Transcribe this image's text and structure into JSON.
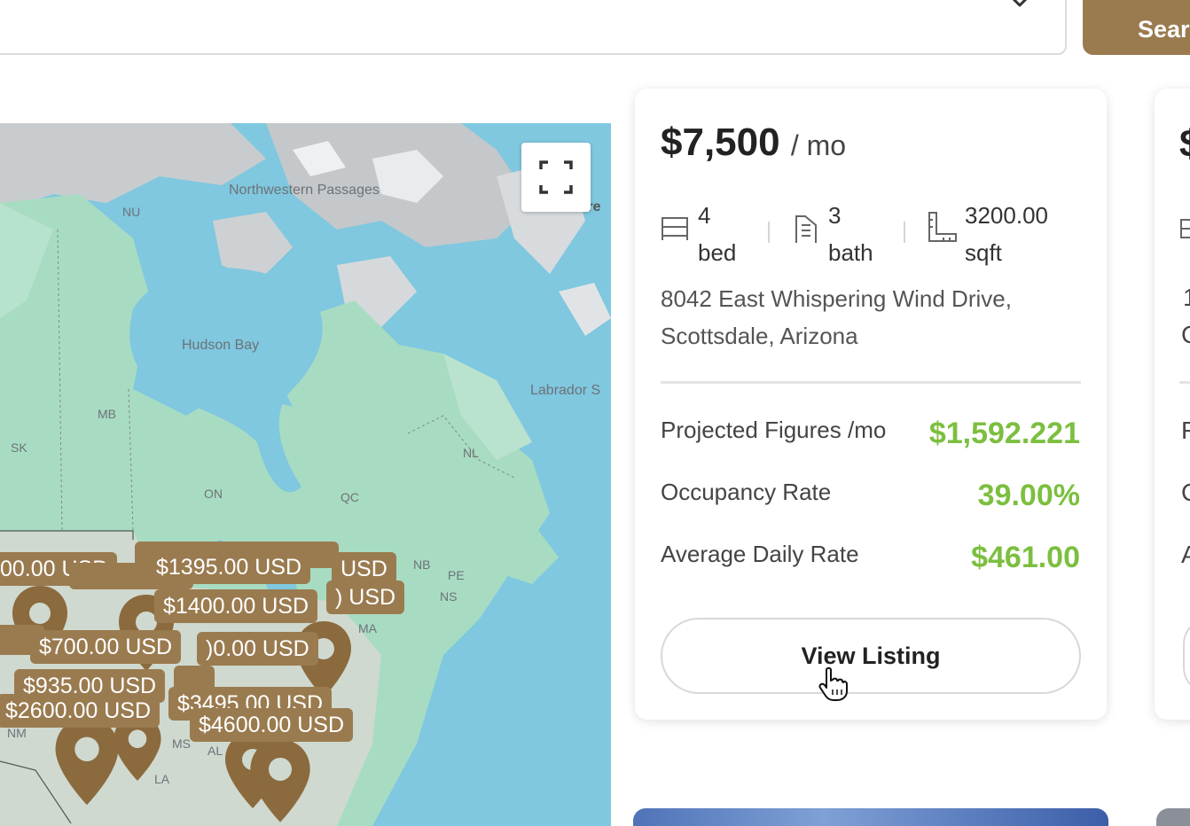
{
  "search": {
    "button_label": "Sear",
    "dropdown_icon": "chevron-down-icon"
  },
  "map": {
    "labels": {
      "northwestern_passages": "Northwestern Passages",
      "nu": "NU",
      "hudson_bay": "Hudson Bay",
      "labrador": "Labrador S",
      "mb": "MB",
      "sk": "SK",
      "on": "ON",
      "qc": "QC",
      "nl": "NL",
      "nb": "NB",
      "pe": "PE",
      "ns": "NS",
      "ma": "MA",
      "nm": "NM",
      "ms": "MS",
      "al": "AL",
      "la": "LA",
      "gre": "Gre"
    },
    "price_tags": [
      "00.00 USD",
      "$1395.00 USD",
      "USD",
      "$1400.00 USD",
      ") USD",
      "$700.00 USD",
      ")0.00 USD",
      "$935.00 USD",
      "$2600.00 USD",
      "$3495.00 USD",
      "$4600.00 USD"
    ],
    "fullscreen_icon": "fullscreen-icon",
    "pin_color": "#8b6a3e",
    "water_color": "#7fc8df",
    "land_color": "#a8dcc2"
  },
  "listing": {
    "price": "$7,500",
    "per": "/ mo",
    "beds_value": "4",
    "beds_label": "bed",
    "baths_value": "3",
    "baths_label": "bath",
    "sqft_value": "3200.00",
    "sqft_label": "sqft",
    "address_line1": "8042 East Whispering Wind Drive,",
    "address_line2": "Scottsdale, Arizona",
    "metrics": [
      {
        "label": "Projected Figures /mo",
        "value": "$1,592.221"
      },
      {
        "label": "Occupancy Rate",
        "value": "39.00%"
      },
      {
        "label": "Average Daily Rate",
        "value": "$461.00"
      }
    ],
    "view_button": "View Listing",
    "accent_green": "#7cbf3f",
    "brand_brown": "#9a7b4f"
  },
  "next_card": {
    "price_fragment": "$",
    "line1_fragment": "1",
    "line2_fragment": "C",
    "metric1_fragment": "F",
    "metric2_fragment": "C",
    "metric3_fragment": "A"
  }
}
